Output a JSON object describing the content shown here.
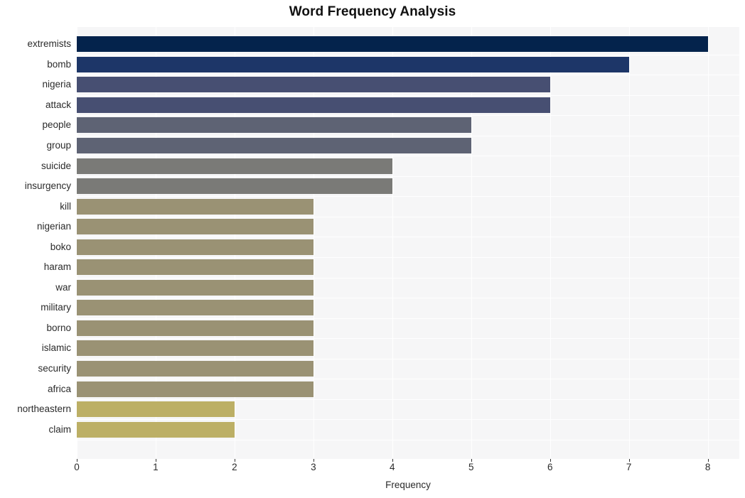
{
  "chart_data": {
    "type": "bar",
    "orientation": "horizontal",
    "title": "Word Frequency Analysis",
    "xlabel": "Frequency",
    "ylabel": "",
    "categories": [
      "extremists",
      "bomb",
      "nigeria",
      "attack",
      "people",
      "group",
      "suicide",
      "insurgency",
      "kill",
      "nigerian",
      "boko",
      "haram",
      "war",
      "military",
      "borno",
      "islamic",
      "security",
      "africa",
      "northeastern",
      "claim"
    ],
    "values": [
      8,
      7,
      6,
      6,
      5,
      5,
      4,
      4,
      3,
      3,
      3,
      3,
      3,
      3,
      3,
      3,
      3,
      3,
      2,
      2
    ],
    "bar_colors": [
      "#04234c",
      "#1d3668",
      "#474f72",
      "#474f72",
      "#5e6374",
      "#5e6374",
      "#7a7a77",
      "#7a7a77",
      "#9a9274",
      "#9a9274",
      "#9a9274",
      "#9a9274",
      "#9a9274",
      "#9a9274",
      "#9a9274",
      "#9a9274",
      "#9a9274",
      "#9a9274",
      "#bcaf65",
      "#bcaf65"
    ],
    "xlim": [
      0,
      8.4
    ],
    "xticks": [
      0,
      1,
      2,
      3,
      4,
      5,
      6,
      7,
      8
    ],
    "xticklabels": [
      "0",
      "1",
      "2",
      "3",
      "4",
      "5",
      "6",
      "7",
      "8"
    ],
    "grid": true,
    "grid_color": "#ffffff",
    "plot_background": "#f6f6f7",
    "figure_background": "#ffffff",
    "legend": null,
    "colormap": "cividis"
  }
}
